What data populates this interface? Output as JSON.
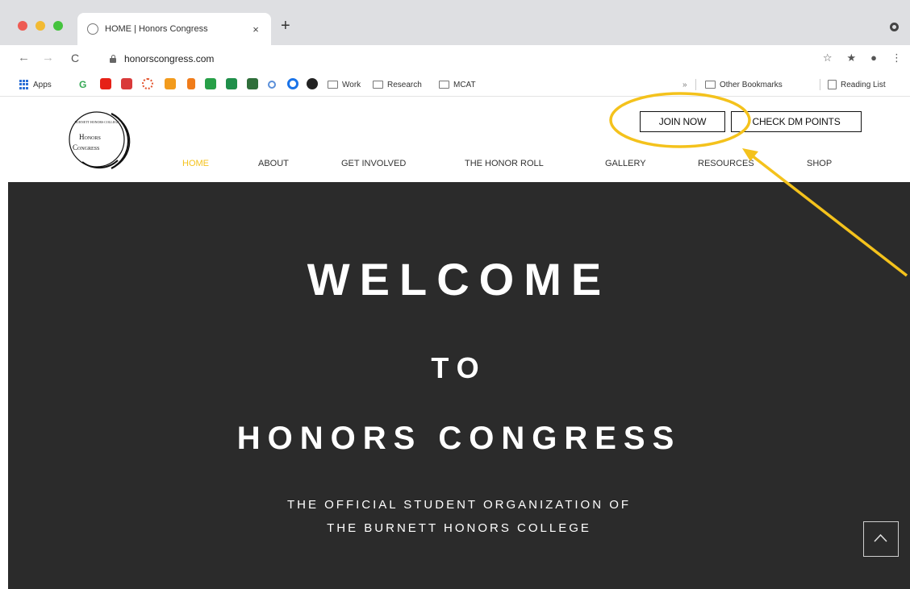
{
  "browser": {
    "tab_title": "HOME | Honors Congress",
    "tab_close": "×",
    "new_tab": "+",
    "url": "honorscongress.com",
    "nav": {
      "back": "←",
      "forward": "→",
      "reload": "C"
    },
    "addr_icons": {
      "star": "☆",
      "extensions": "★",
      "profile": "●",
      "menu": "⋮"
    }
  },
  "bookmarks": {
    "apps": "Apps",
    "g": "G",
    "folders": [
      "Work",
      "Research",
      "MCAT"
    ],
    "overflow": "»",
    "other": "Other Bookmarks",
    "reading": "Reading List"
  },
  "site": {
    "logo": {
      "top_text": "BURNETT HONORS COLLEGE",
      "line1": "Honors",
      "line2": "Congress"
    },
    "buttons": {
      "join": "JOIN NOW",
      "dm_points": "CHECK DM POINTS"
    },
    "nav": [
      "HOME",
      "ABOUT",
      "GET INVOLVED",
      "THE HONOR ROLL",
      "GALLERY",
      "RESOURCES",
      "SHOP"
    ],
    "active_nav": "HOME",
    "hero": {
      "line1": "WELCOME",
      "line2": "TO",
      "line3": "HONORS CONGRESS",
      "sub1": "THE OFFICIAL STUDENT ORGANIZATION OF",
      "sub2": "THE BURNETT HONORS COLLEGE"
    }
  },
  "colors": {
    "accent": "#f4c21c",
    "hero_bg": "#2b2b2b",
    "annotation": "#f4c21c"
  }
}
